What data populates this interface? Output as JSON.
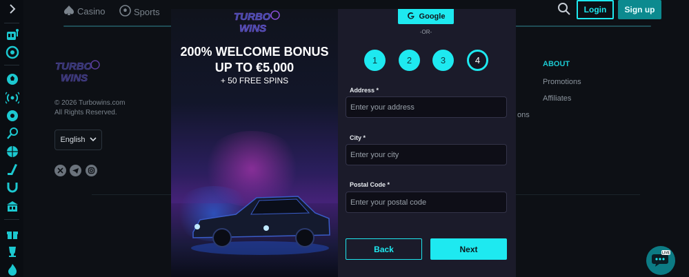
{
  "nav": {
    "casino_label": "Casino",
    "sports_label": "Sports",
    "login_label": "Login",
    "signup_label": "Sign up"
  },
  "rail": {
    "icons": [
      "chevron-right-icon",
      "slot-machine-icon",
      "wheel-icon",
      "sports-ball-icon",
      "live-icon",
      "soccer-icon",
      "tennis-icon",
      "basketball-icon",
      "hockey-icon",
      "horseshoe-icon",
      "casino-building-icon",
      "gift-icon",
      "trophy-icon",
      "fire-icon"
    ]
  },
  "footer": {
    "logo_text_top": "TURBO",
    "logo_text_bottom": "WINS",
    "copyright_line1": "© 2026 Turbowins.com",
    "copyright_line2": "All Rights Reserved.",
    "language": "English",
    "about_heading": "ABOUT",
    "about_links": [
      "Promotions",
      "Affiliates"
    ],
    "partial_text": "ons"
  },
  "promo": {
    "logo_text_top": "TURBO",
    "logo_text_bottom": "WINS",
    "title_line1": "200% WELCOME BONUS",
    "title_line2": "UP TO €5,000",
    "subtitle": "+ 50 FREE SPINS"
  },
  "form": {
    "google_label": "Google",
    "or_label": "-OR-",
    "steps": [
      "1",
      "2",
      "3",
      "4"
    ],
    "current_step": 4,
    "fields": [
      {
        "label": "Address *",
        "placeholder": "Enter your address"
      },
      {
        "label": "City *",
        "placeholder": "Enter your city"
      },
      {
        "label": "Postal Code *",
        "placeholder": "Enter your postal code"
      }
    ],
    "back_label": "Back",
    "next_label": "Next"
  },
  "chat": {
    "badge": "LIVE"
  },
  "colors": {
    "accent": "#1ee9f0",
    "background": "#0d1015",
    "modal": "#1b1b2a"
  }
}
